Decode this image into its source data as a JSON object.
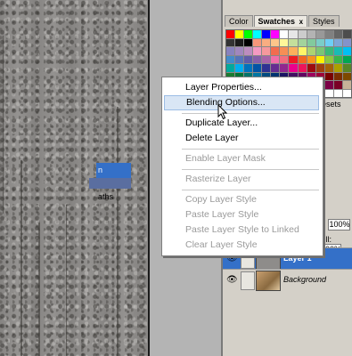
{
  "palette": {
    "tabs": [
      {
        "label": "Color",
        "active": false
      },
      {
        "label": "Swatches",
        "active": true
      },
      {
        "label": "Styles",
        "active": false
      }
    ],
    "close_glyph": "x",
    "presets_tab_label": "resets",
    "active_layer_fragment": "n",
    "paths_tab_fragment": "aths",
    "opacity_label": "y:",
    "opacity_value": "100%",
    "fill_label": "Fill:",
    "fill_value": "100%"
  },
  "swatch_colors": [
    "#ff0000",
    "#ffff00",
    "#00ff00",
    "#00ffff",
    "#0000ff",
    "#ff00ff",
    "#ffffff",
    "#e6e6e6",
    "#cccccc",
    "#b3b3b3",
    "#999999",
    "#808080",
    "#666666",
    "#4d4d4d",
    "#333333",
    "#1a1a1a",
    "#000000",
    "#f7977a",
    "#f9ad81",
    "#fdc68a",
    "#fff79a",
    "#c4df9b",
    "#a3d39c",
    "#82ca9d",
    "#7bcdc8",
    "#6ecff6",
    "#7ea7d8",
    "#8493ca",
    "#8882be",
    "#a187be",
    "#bc8dbf",
    "#f49ac2",
    "#f6989d",
    "#f26c4f",
    "#f68e55",
    "#fbaf5c",
    "#fff467",
    "#acd372",
    "#7cc576",
    "#3bb878",
    "#1abbb4",
    "#00bff3",
    "#438ccb",
    "#5574b9",
    "#605ca8",
    "#855fa8",
    "#a763a8",
    "#f06ea9",
    "#f26d7d",
    "#ed1c24",
    "#f26522",
    "#f7941d",
    "#fff200",
    "#8dc73f",
    "#39b54a",
    "#00a651",
    "#00a99d",
    "#00aeef",
    "#0072bc",
    "#0054a6",
    "#2e3192",
    "#662d91",
    "#92278f",
    "#ec008c",
    "#ed145b",
    "#9e0b0f",
    "#a0410d",
    "#a36209",
    "#aba000",
    "#598527",
    "#1a7b30",
    "#007236",
    "#00746b",
    "#0076a3",
    "#004b80",
    "#003471",
    "#1b1464",
    "#440e62",
    "#630460",
    "#9e005d",
    "#9e0039",
    "#790000",
    "#7b2e00",
    "#7d4900",
    "#827b00",
    "#406618",
    "#005e20",
    "#005826",
    "#005952",
    "#005b7f",
    "#003663",
    "#002157",
    "#0d004c",
    "#32004b",
    "#4b0049",
    "#7b0046",
    "#7a0026",
    "#c7b299",
    "#998675",
    "#736357",
    "#534741",
    "#37302d",
    "#c69c6d",
    "#a67c52",
    "#8c6239",
    "#754c24",
    "#603913",
    "#3c2415",
    "#ffffff",
    "#ffffff",
    "#ffffff",
    "#ffffff"
  ],
  "layers": [
    {
      "name": "Layer 1",
      "selected": true,
      "visibility_glyph": "👁"
    },
    {
      "name": "Background",
      "selected": false,
      "visibility_glyph": "👁"
    }
  ],
  "context_menu": {
    "items": [
      {
        "label": "Layer Properties...",
        "enabled": true,
        "hover": false
      },
      {
        "label": "Blending Options...",
        "enabled": true,
        "hover": true
      },
      {
        "label": "Duplicate Layer...",
        "enabled": true,
        "hover": false
      },
      {
        "label": "Delete Layer",
        "enabled": true,
        "hover": false
      },
      {
        "label": "Enable Layer Mask",
        "enabled": false,
        "hover": false
      },
      {
        "label": "Rasterize Layer",
        "enabled": false,
        "hover": false
      },
      {
        "label": "Copy Layer Style",
        "enabled": false,
        "hover": false
      },
      {
        "label": "Paste Layer Style",
        "enabled": false,
        "hover": false
      },
      {
        "label": "Paste Layer Style to Linked",
        "enabled": false,
        "hover": false
      },
      {
        "label": "Clear Layer Style",
        "enabled": false,
        "hover": false
      }
    ]
  },
  "icons": {
    "cursor": "arrow-cursor-icon",
    "eye": "eye-icon",
    "brush": "brush-icon"
  },
  "colors": {
    "selection_blue": "#3470c8",
    "menu_hover": "#d9e6f5",
    "panel_gray": "#d4d0c8"
  }
}
